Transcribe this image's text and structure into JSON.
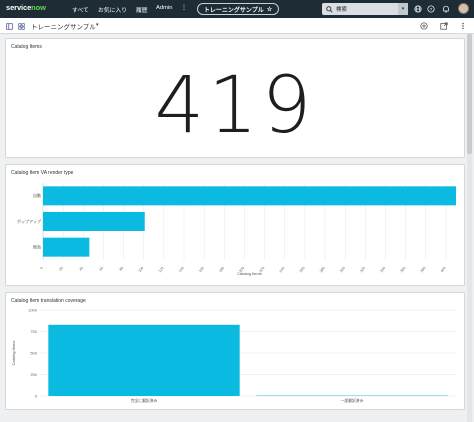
{
  "topnav": {
    "logo_part1": "service",
    "logo_part2": "now",
    "links": [
      "すべて",
      "お気に入り",
      "履歴",
      "Admin"
    ],
    "more": "⋮",
    "app_title": "トレーニングサンプル",
    "star": "☆",
    "search_placeholder": "検索"
  },
  "subheader": {
    "title": "トレーニングサンプル",
    "caret": "▾"
  },
  "cards": {
    "catalog_items": {
      "title": "Catalog Items",
      "value": "419"
    }
  },
  "chart_data": [
    {
      "type": "bar",
      "orientation": "horizontal",
      "title": "Catalog Item VA render type",
      "categories": [
        "自動",
        "ポップアップ",
        "無効"
      ],
      "values": [
        410,
        101,
        46
      ],
      "xlabel": "Catalog Items",
      "ylabel": "",
      "xlim": [
        0,
        410
      ],
      "xticks": [
        0,
        20,
        40,
        60,
        80,
        100,
        120,
        140,
        160,
        180,
        200,
        220,
        240,
        260,
        280,
        300,
        320,
        340,
        360,
        380,
        400
      ],
      "color": "#0abae0",
      "grid": true
    },
    {
      "type": "bar",
      "orientation": "vertical",
      "title": "Catalog Item translation coverage",
      "categories": [
        "完全に翻訳済み",
        "一部翻訳済み"
      ],
      "values": [
        828,
        5
      ],
      "xlabel": "",
      "ylabel": "Catalog Items",
      "ylim": [
        0,
        1000
      ],
      "yticks": [
        0,
        250,
        500,
        750,
        1000
      ],
      "color": "#0abae0",
      "grid": true
    }
  ],
  "colors": {
    "topbar": "#1d2c35",
    "accent": "#62d84e",
    "bar": "#0abae0"
  },
  "icons": {
    "left": "sidebar-toggle-icon",
    "dashboard": "dashboard-grid-icon",
    "globe": "globe-icon",
    "help": "help-icon",
    "bell": "bell-icon",
    "add": "add-icon",
    "share": "share-icon",
    "more": "more-icon"
  }
}
